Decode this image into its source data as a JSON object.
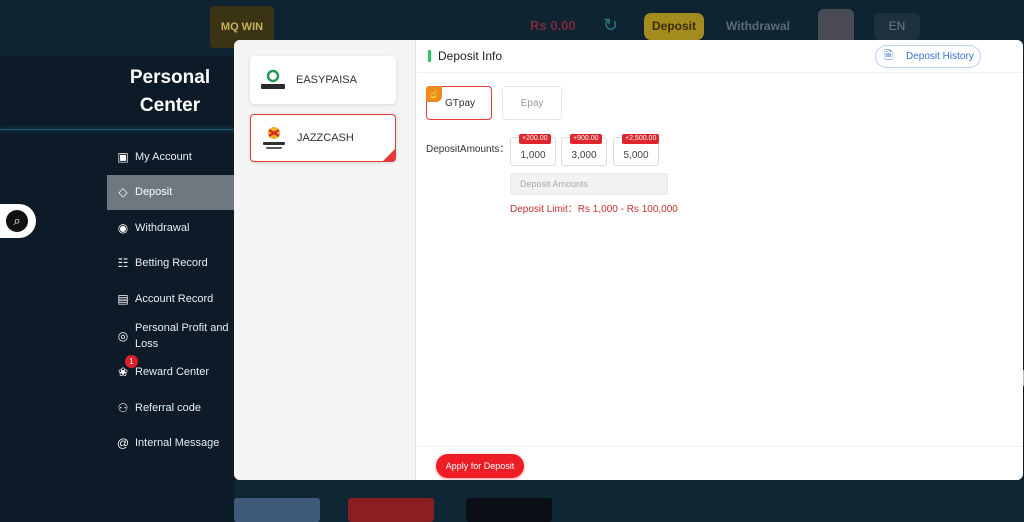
{
  "topbar": {
    "logo_text": "MQ WIN",
    "balance_text": "Rs 0.00",
    "deposit_label": "Deposit",
    "withdrawal_label": "Withdrawal",
    "language": "EN"
  },
  "sidebar": {
    "title_line1": "Personal",
    "title_line2": "Center",
    "items": [
      {
        "label": "My Account",
        "icon": "account-icon"
      },
      {
        "label": "Deposit",
        "icon": "deposit-icon",
        "active": true
      },
      {
        "label": "Withdrawal",
        "icon": "withdrawal-icon"
      },
      {
        "label": "Betting Record",
        "icon": "betting-record-icon"
      },
      {
        "label": "Account Record",
        "icon": "account-record-icon"
      },
      {
        "label": "Personal Profit and Loss",
        "icon": "profit-loss-icon"
      },
      {
        "label": "Reward Center",
        "icon": "reward-icon",
        "badge": "1"
      },
      {
        "label": "Referral code",
        "icon": "referral-icon"
      },
      {
        "label": "Internal Message",
        "icon": "message-icon"
      }
    ]
  },
  "modal": {
    "methods": [
      {
        "label": "EASYPAISA",
        "logo_text": "easypaisa"
      },
      {
        "label": "JAZZCASH",
        "logo_text": "JazzCash",
        "selected": true
      }
    ],
    "header_title": "Deposit Info",
    "history_label": "Deposit History",
    "channels": [
      {
        "label": "GTpay",
        "selected": true
      },
      {
        "label": "Epay",
        "selected": false
      }
    ],
    "amounts_label": "DepositAmounts：",
    "amounts": [
      {
        "value": "1,000",
        "bonus": "+200.00"
      },
      {
        "value": "3,000",
        "bonus": "+900.00"
      },
      {
        "value": "5,000",
        "bonus": "+2,500.00"
      }
    ],
    "amount_placeholder": "Deposit Amounts",
    "limit_text": "Deposit Limit：Rs  1,000  -  Rs  100,000",
    "apply_label": "Apply for Deposit"
  },
  "colors": {
    "accent_red": "#ee1c25",
    "success_green": "#22c55e",
    "history_blue": "#3b6fd4"
  }
}
